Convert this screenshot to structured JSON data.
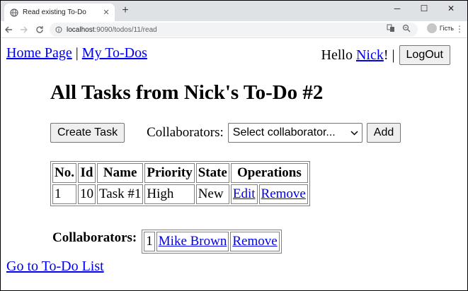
{
  "browser": {
    "tab_title": "Read existing To-Do",
    "tab_close": "✕",
    "new_tab": "+",
    "window_controls": [
      "─",
      "☐",
      "✕"
    ],
    "url_host": "localhost",
    "url_path": ":9090/todos/11/read",
    "profile_label": "Гість",
    "icons": [
      "back-icon",
      "forward-icon",
      "reload-icon",
      "translate-icon",
      "zoom-icon",
      "profile-icon",
      "menu-icon"
    ]
  },
  "nav": {
    "home_link": "Home Page",
    "separator": "|",
    "mytodos_link": "My To-Dos"
  },
  "user": {
    "greeting": "Hello ",
    "name": "Nick",
    "suffix": "! |",
    "logout_label": "LogOut"
  },
  "page": {
    "title": "All Tasks from Nick's To-Do #2",
    "create_task_label": "Create Task",
    "collaborators_label": "Collaborators:",
    "select_value": "Select collaborator...",
    "add_label": "Add"
  },
  "tasks_table": {
    "headers": [
      "No.",
      "Id",
      "Name",
      "Priority",
      "State",
      "Operations"
    ],
    "rows": [
      {
        "no": "1",
        "id": "10",
        "name": "Task #1",
        "priority": "High",
        "state": "New",
        "edit": "Edit",
        "remove": "Remove"
      }
    ]
  },
  "collaborators": {
    "label": "Collaborators:",
    "rows": [
      {
        "no": "1",
        "name": "Mike Brown",
        "remove": "Remove"
      }
    ]
  },
  "footer": {
    "back_link": "Go to To-Do List"
  }
}
